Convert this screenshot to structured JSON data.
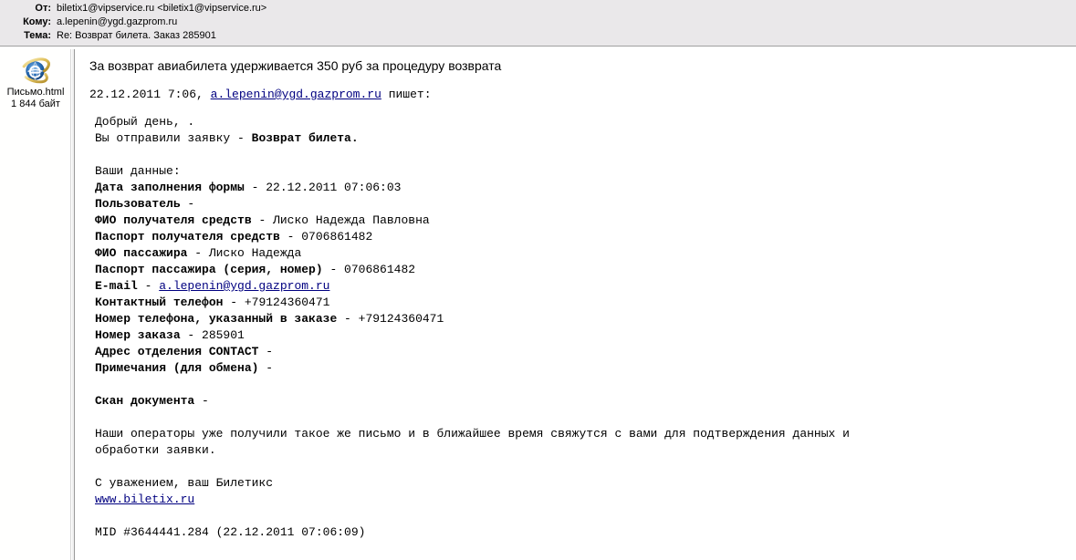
{
  "window": {
    "title": "Re: Возврат билета. Заказ 285901"
  },
  "header": {
    "from_label": "От:",
    "from_value": "biletix1@vipservice.ru <biletix1@vipservice.ru>",
    "to_label": "Кому:",
    "to_value": "a.lepenin@ygd.gazprom.ru",
    "subject_label": "Тема:",
    "subject_value": "Re: Возврат билета. Заказ 285901"
  },
  "attachments": [
    {
      "icon": "internet-explorer-icon",
      "name": "Письмо.html",
      "size": "1 844 байт"
    }
  ],
  "message": {
    "notice": "За возврат авиабилета удерживается 350 руб за процедуру возврата",
    "attribution": {
      "datetime": "22.12.2011 7:06,",
      "email": "a.lepenin@ygd.gazprom.ru",
      "verb": "пишет:"
    },
    "greeting": "Добрый день, .",
    "request_prefix": "Вы отправили заявку - ",
    "request_type": "Возврат билета.",
    "data_heading": "Ваши данные:",
    "fields": [
      {
        "label": "Дата заполнения формы",
        "sep": " - ",
        "value": "22.12.2011 07:06:03"
      },
      {
        "label": "Пользователь",
        "sep": " -",
        "value": ""
      },
      {
        "label": "ФИО получателя средств",
        "sep": " - ",
        "value": "Лиско Надежда Павловна"
      },
      {
        "label": "Паспорт получателя средств",
        "sep": " - ",
        "value": "0706861482"
      },
      {
        "label": "ФИО пассажира",
        "sep": " - ",
        "value": "Лиско Надежда"
      },
      {
        "label": "Паспорт пассажира (серия, номер)",
        "sep": " - ",
        "value": "0706861482"
      },
      {
        "label": "E-mail",
        "sep": " - ",
        "value": "a.lepenin@ygd.gazprom.ru",
        "is_link": true
      },
      {
        "label": "Контактный телефон",
        "sep": " - ",
        "value": "+79124360471"
      },
      {
        "label": "Номер телефона, указанный в заказе",
        "sep": " - ",
        "value": "+79124360471"
      },
      {
        "label": "Номер заказа",
        "sep": " - ",
        "value": "285901"
      },
      {
        "label": "Адрес отделения CONTACT",
        "sep": " -",
        "value": ""
      },
      {
        "label": "Примечания (для обмена)",
        "sep": " -",
        "value": ""
      }
    ],
    "scan_label": "Скан документа",
    "scan_sep": " -",
    "paragraph_line1": "Наши операторы уже получили такое же письмо и в ближайшее время свяжутся с вами для подтверждения данных и",
    "paragraph_line2": "обработки заявки.",
    "signature": "С уважением, ваш Билетикс",
    "site_link": "www.biletix.ru",
    "mid": "MID #3644441.284 (22.12.2011 07:06:09)"
  },
  "colors": {
    "header_bg": "#eae8ea",
    "link": "#000080",
    "text": "#000000",
    "pane_bg": "#ffffff"
  }
}
